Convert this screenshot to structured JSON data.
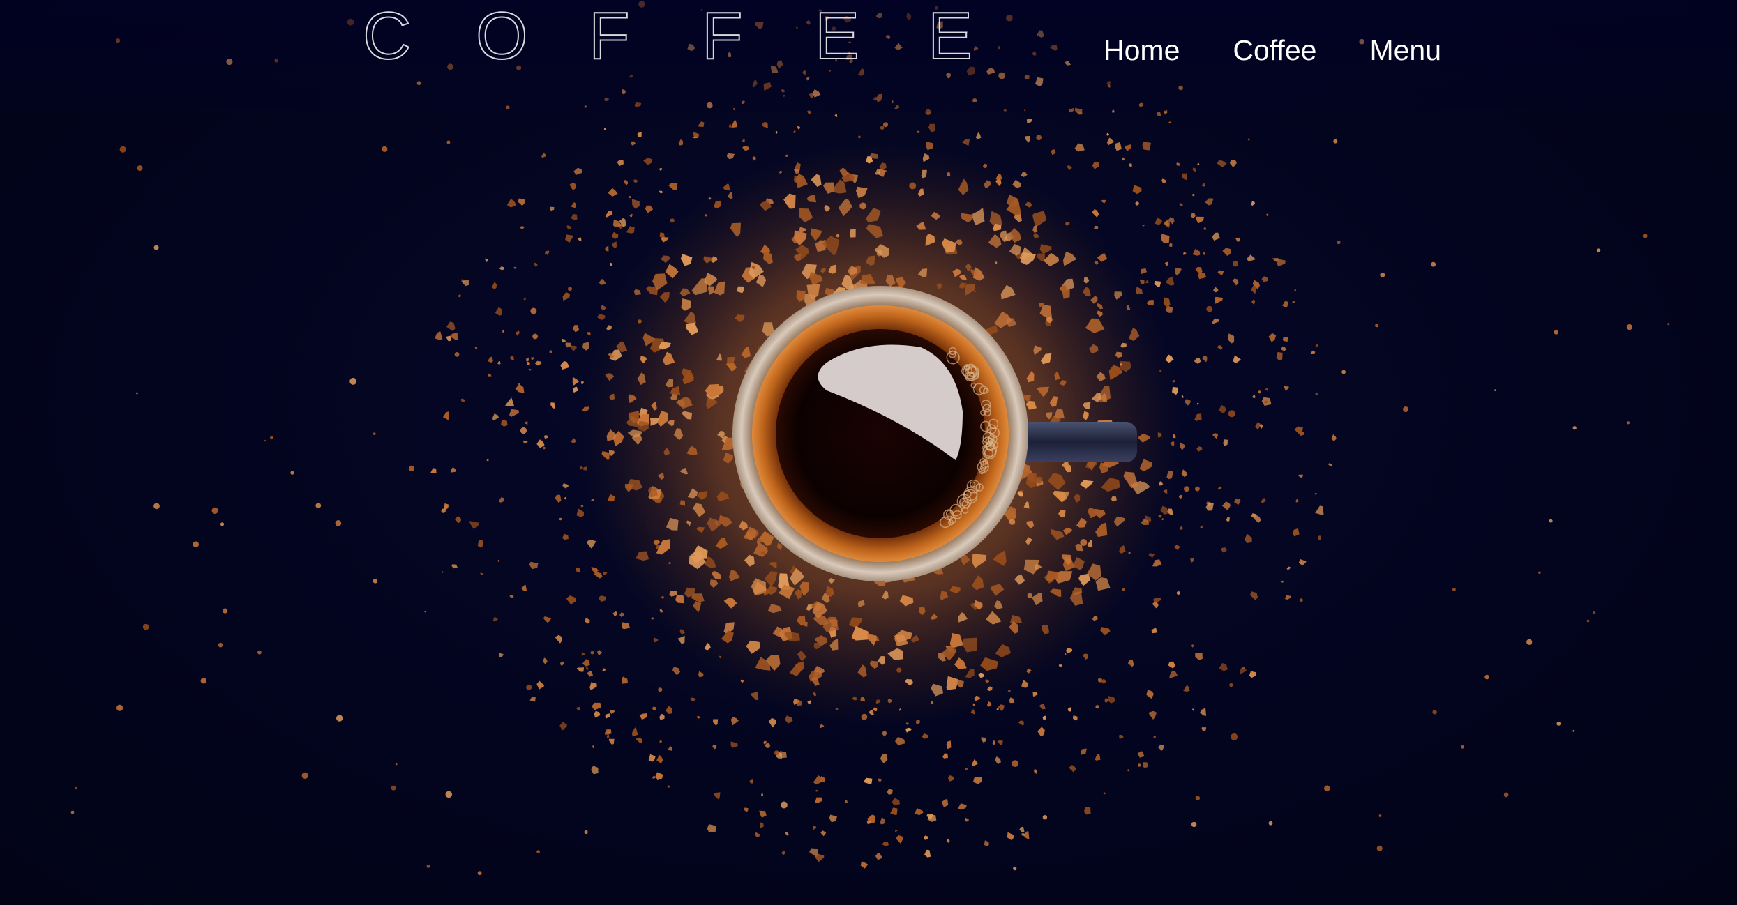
{
  "header": {
    "logo_letters": [
      "C",
      "O",
      "F",
      "F",
      "E",
      "E"
    ],
    "nav": [
      {
        "label": "Home"
      },
      {
        "label": "Coffee"
      },
      {
        "label": "Menu"
      }
    ]
  },
  "hero": {
    "image_description_icon": "coffee-cup-with-grounds-image"
  },
  "colors": {
    "background": "#03041f",
    "grounds": "#c9773a",
    "text": "#ffffff"
  }
}
